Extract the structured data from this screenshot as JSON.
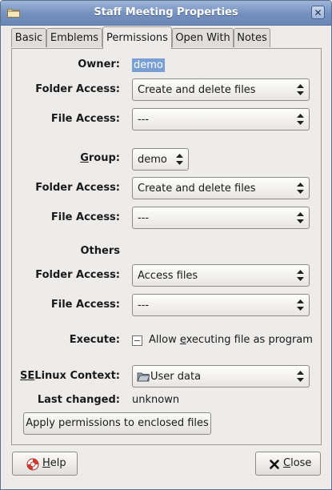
{
  "window": {
    "title": "Staff Meeting Properties",
    "close_glyph": "✕"
  },
  "tabs": [
    {
      "label": "Basic"
    },
    {
      "label": "Emblems"
    },
    {
      "label": "Permissions",
      "active": true
    },
    {
      "label": "Open With"
    },
    {
      "label": "Notes"
    }
  ],
  "owner": {
    "label": "Owner:",
    "value": "demo",
    "folder_access_label": "Folder Access:",
    "folder_access_value": "Create and delete files",
    "file_access_label": "File Access:",
    "file_access_value": "---"
  },
  "group": {
    "label_mnemonic": "G",
    "label_rest": "roup:",
    "value": "demo",
    "folder_access_label": "Folder Access:",
    "folder_access_value": "Create and delete files",
    "file_access_label": "File Access:",
    "file_access_value": "---"
  },
  "others": {
    "heading": "Others",
    "folder_access_label": "Folder Access:",
    "folder_access_value": "Access files",
    "file_access_label": "File Access:",
    "file_access_value": "---"
  },
  "execute": {
    "label": "Execute:",
    "checkbox_pre": "Allow ",
    "checkbox_mnemonic": "e",
    "checkbox_post": "xecuting file as program",
    "checked": false
  },
  "selinux": {
    "label_mnemonic": "SE",
    "label_rest": "Linux Context:",
    "value": "User data",
    "icon": "folder-icon"
  },
  "last_changed": {
    "label": "Last changed:",
    "value": "unknown"
  },
  "apply_button": {
    "label": "Apply permissions to enclosed files"
  },
  "footer": {
    "help_mnemonic": "H",
    "help_rest": "elp",
    "help_icon": "lifebuoy-icon",
    "close_mnemonic": "C",
    "close_rest": "lose",
    "close_icon": "close-x-icon"
  },
  "colors": {
    "titlebar": "#7590be",
    "selection": "#7a9fd4",
    "dialog_bg": "#edeceb"
  }
}
